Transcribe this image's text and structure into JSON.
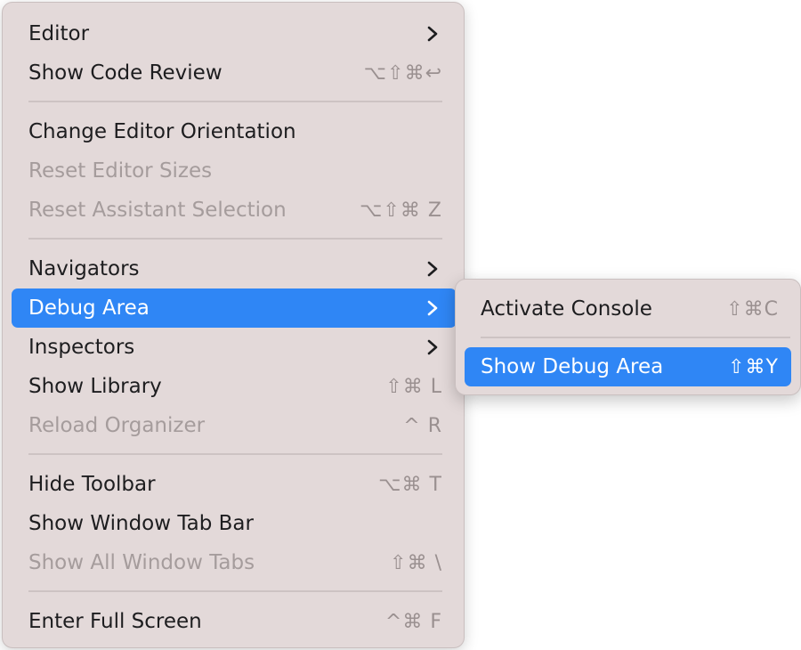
{
  "menu": {
    "items": [
      {
        "label": "Editor",
        "shortcut": "",
        "submenu": true
      },
      {
        "label": "Show Code Review",
        "shortcut": "⌥⇧⌘↩"
      },
      {
        "label": "Change Editor Orientation",
        "shortcut": ""
      },
      {
        "label": "Reset Editor Sizes",
        "shortcut": "",
        "disabled": true
      },
      {
        "label": "Reset Assistant Selection",
        "shortcut": "⌥⇧⌘ Z",
        "disabled": true
      },
      {
        "label": "Navigators",
        "shortcut": "",
        "submenu": true
      },
      {
        "label": "Debug Area",
        "shortcut": "",
        "submenu": true,
        "highlighted": true
      },
      {
        "label": "Inspectors",
        "shortcut": "",
        "submenu": true
      },
      {
        "label": "Show Library",
        "shortcut": "⇧⌘ L"
      },
      {
        "label": "Reload Organizer",
        "shortcut": "^ R",
        "disabled": true
      },
      {
        "label": "Hide Toolbar",
        "shortcut": "⌥⌘ T"
      },
      {
        "label": "Show Window Tab Bar",
        "shortcut": ""
      },
      {
        "label": "Show All Window Tabs",
        "shortcut": "⇧⌘ \\",
        "disabled": true
      },
      {
        "label": "Enter Full Screen",
        "shortcut": "^⌘ F"
      }
    ]
  },
  "submenu": {
    "items": [
      {
        "label": "Activate Console",
        "shortcut": "⇧⌘C"
      },
      {
        "label": "Show Debug Area",
        "shortcut": "⇧⌘Y",
        "highlighted": true
      }
    ]
  },
  "colors": {
    "menu_background": "#e3d9d9",
    "highlight": "#2f86f5",
    "text": "#1d1d1f",
    "disabled_text": "#a59c9c",
    "shortcut_text": "#9a9090"
  },
  "icons": {
    "submenu_arrow": "chevron-right-icon"
  }
}
